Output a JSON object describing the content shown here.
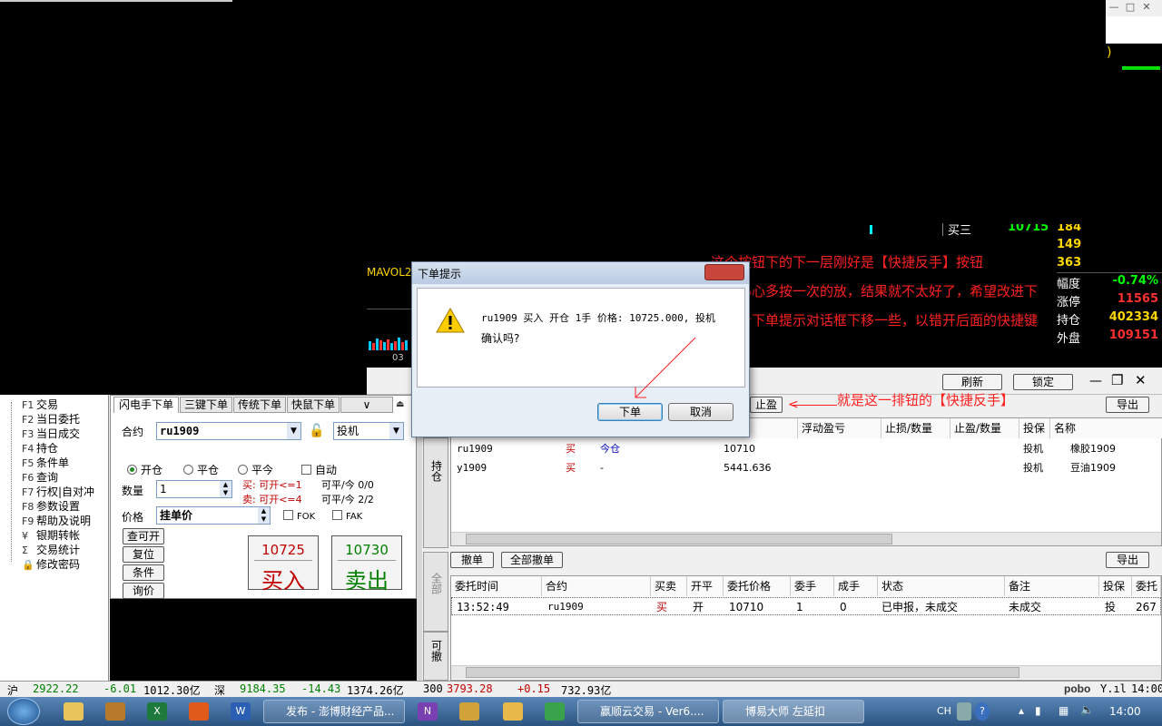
{
  "window": {
    "controls": [
      "—",
      "□",
      "✕"
    ]
  },
  "chart": {
    "paren": ")",
    "mavol_label": "MAVOL2",
    "axis_label": "03",
    "partial_label": "买三",
    "partial_value": "10715",
    "partial_qty": "184",
    "qty_rows": [
      "149",
      "363"
    ]
  },
  "quote": {
    "rows": [
      {
        "label": "幅度",
        "value": "-0.74%",
        "color": "#00ff00"
      },
      {
        "label": "涨停",
        "value": "11565",
        "color": "#ff3030"
      },
      {
        "label": "持仓",
        "value": "402334",
        "color": "#ffd700"
      },
      {
        "label": "外盘",
        "value": "109151",
        "color": "#ff3030"
      }
    ]
  },
  "annotation": {
    "line1": "这个按钮下的下一层刚好是【快捷反手】按钮",
    "line2": "若不小心多按一次的放，结果就不太好了，希望改进下",
    "line3": "把这个下单提示对话框下移一些，以错开后面的快捷键",
    "line4": "就是这一排钮的【快捷反手】"
  },
  "toolbar": {
    "refresh": "刷新",
    "lock": "锁定",
    "export": "导出",
    "stop_profit": "止盈"
  },
  "menu": {
    "items": [
      {
        "key": "F1",
        "label": "交易"
      },
      {
        "key": "F2",
        "label": "当日委托"
      },
      {
        "key": "F3",
        "label": "当日成交"
      },
      {
        "key": "F4",
        "label": "持仓"
      },
      {
        "key": "F5",
        "label": "条件单"
      },
      {
        "key": "F6",
        "label": "查询"
      },
      {
        "key": "F7",
        "label": "行权|自对冲"
      },
      {
        "key": "F8",
        "label": "参数设置"
      },
      {
        "key": "F9",
        "label": "帮助及说明"
      },
      {
        "key": "¥",
        "label": "银期转帐"
      },
      {
        "key": "Σ",
        "label": "交易统计"
      },
      {
        "key": "🔒",
        "label": "修改密码"
      }
    ]
  },
  "order": {
    "tabs": [
      "闪电手下单",
      "三键下单",
      "传统下单",
      "快鼠下单"
    ],
    "contract_label": "合约",
    "contract_value": "ru1909",
    "hedge_value": "投机",
    "open_label": "开仓",
    "close_label": "平仓",
    "close_today_label": "平今",
    "auto_label": "自动",
    "qty_label": "数量",
    "qty_value": "1",
    "buy_info": "买: 可开<=1",
    "sell_info": "卖: 可开<=4",
    "buy_close_info": "可平/今 0/0",
    "sell_close_info": "可平/今 2/2",
    "price_label": "价格",
    "price_value": "挂单价",
    "fok": "FOK",
    "fak": "FAK",
    "query_btn": "查可开",
    "reset_btn": "复位",
    "cond_btn": "条件",
    "ask_btn": "询价",
    "buy_price": "10725",
    "buy_label": "买入",
    "sell_price": "10730",
    "sell_label": "卖出"
  },
  "vtabs": {
    "position": "持仓",
    "all": "全部",
    "cancellable": "可撤"
  },
  "positions": {
    "headers": [
      "价",
      "浮动盈亏",
      "止损/数量",
      "止盈/数量",
      "投保",
      "名称"
    ],
    "rows": [
      {
        "contract": "ru1909",
        "side": "买",
        "type": "今仓",
        "price": "10710",
        "hedge": "投机",
        "name": "橡胶1909"
      },
      {
        "contract": "y1909",
        "side": "买",
        "type": "-",
        "price": "5441.636",
        "hedge": "投机",
        "name": "豆油1909"
      }
    ]
  },
  "orders": {
    "cancel_btn": "撤单",
    "cancel_all_btn": "全部撤单",
    "export_btn": "导出",
    "headers": [
      "委托时间",
      "合约",
      "买卖",
      "开平",
      "委托价格",
      "委手",
      "成手",
      "状态",
      "备注",
      "投保",
      "委托"
    ],
    "rows": [
      {
        "time": "13:52:49",
        "contract": "ru1909",
        "side": "买",
        "oc": "开",
        "price": "10710",
        "qty": "1",
        "filled": "0",
        "status": "已申报，未成交",
        "note": "未成交",
        "hedge": "投",
        "extra": "267"
      }
    ]
  },
  "dialog": {
    "title": "下单提示",
    "message": "ru1909 买入 开仓 1手 价格: 10725.000, 投机",
    "confirm": "确认吗?",
    "ok": "下单",
    "cancel": "取消"
  },
  "status": {
    "sh_label": "沪",
    "sh_index": "2922.22",
    "sh_change": "-6.01",
    "sh_amount": "1012.30亿",
    "sz_label": "深",
    "sz_index": "9184.35",
    "sz_change": "-14.43",
    "sz_amount": "1374.26亿",
    "c300_label": "300",
    "c300_index": "3793.28",
    "c300_change": "+0.15",
    "c300_amount": "732.93亿",
    "brand": "pobo",
    "time": "14:00"
  },
  "taskbar": {
    "tasks": [
      "发布 - 澎博财经产品...",
      "赢顺云交易 - Ver6....",
      "博易大师 左延扣"
    ],
    "lang": "CH",
    "clock": "14:00"
  }
}
